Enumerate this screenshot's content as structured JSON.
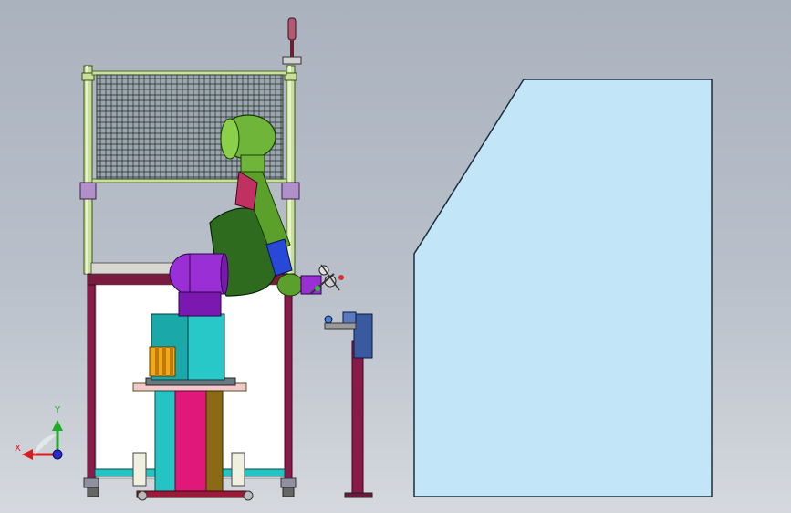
{
  "viewport": {
    "background_top": "#aab2be",
    "background_bottom": "#d5d9de"
  },
  "triad": {
    "x_label": "X",
    "y_label": "Y",
    "x_color": "#d42020",
    "y_color": "#1faa2a",
    "z_color": "#2a2ad0"
  },
  "colors": {
    "robot_green": "#6fb53a",
    "robot_dark_green": "#2f6b1e",
    "robot_purple": "#9b2fd6",
    "pedestal_magenta": "#e0187a",
    "pedestal_cyan": "#25c4c4",
    "pedestal_brown": "#8a6a14",
    "frame_maroon": "#8a1a4a",
    "safety_glass": "#c2e6f8",
    "fence_green": "#b8d98a"
  }
}
